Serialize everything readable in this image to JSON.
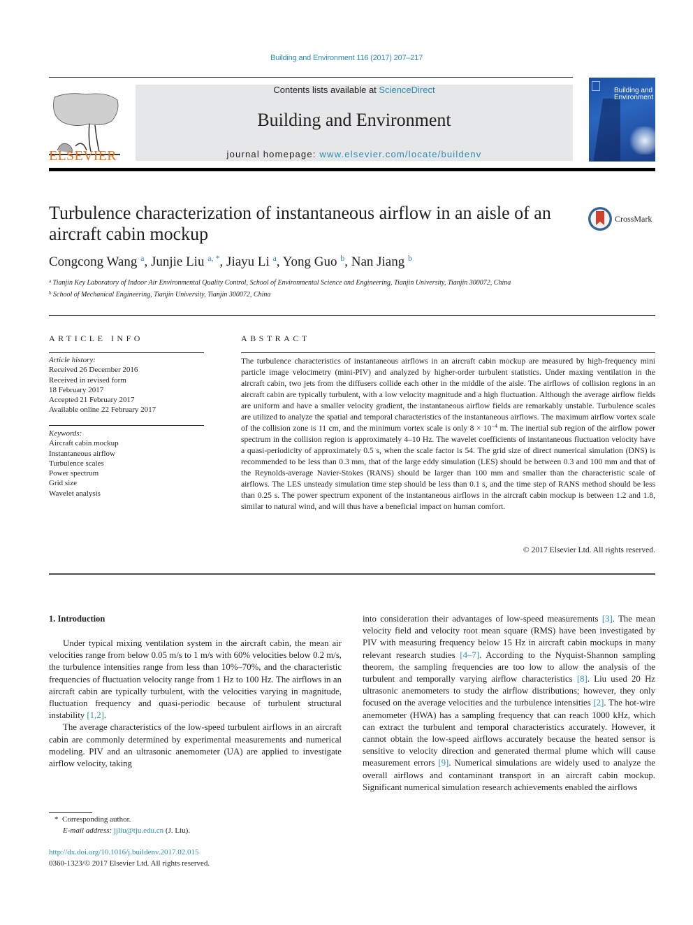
{
  "header": {
    "citation": "Building and Environment 116 (2017) 207–217",
    "contents_prefix": "Contents lists available at ",
    "contents_link": "ScienceDirect",
    "journal_name": "Building and Environment",
    "homepage_prefix": "journal homepage: ",
    "homepage_link": "www.elsevier.com/locate/buildenv",
    "publisher_logo_text": "ELSEVIER",
    "cover_title_line1": "Building and",
    "cover_title_line2": "Environment",
    "crossmark_label": "CrossMark"
  },
  "colors": {
    "link": "#2a8bb5",
    "elsevier_orange": "#e9711c",
    "banner_gray": "#e6e7e8",
    "text": "#231f20"
  },
  "article": {
    "title": "Turbulence characterization of instantaneous airflow in an aisle of an aircraft cabin mockup",
    "authors": [
      {
        "name": "Congcong Wang",
        "sup": "a"
      },
      {
        "name": "Junjie Liu",
        "sup": "a, *"
      },
      {
        "name": "Jiayu Li",
        "sup": "a"
      },
      {
        "name": "Yong Guo",
        "sup": "b"
      },
      {
        "name": "Nan Jiang",
        "sup": "b"
      }
    ],
    "affiliations": [
      {
        "sup": "a",
        "text": "Tianjin Key Laboratory of Indoor Air Environmental Quality Control, School of Environmental Science and Engineering, Tianjin University, Tianjin 300072, China"
      },
      {
        "sup": "b",
        "text": "School of Mechanical Engineering, Tianjin University, Tianjin 300072, China"
      }
    ]
  },
  "article_info": {
    "heading": "ARTICLE INFO",
    "history_label": "Article history:",
    "history": [
      "Received 26 December 2016",
      "Received in revised form",
      "18 February 2017",
      "Accepted 21 February 2017",
      "Available online 22 February 2017"
    ],
    "keywords_label": "Keywords:",
    "keywords": [
      "Aircraft cabin mockup",
      "Instantaneous airflow",
      "Turbulence scales",
      "Power spectrum",
      "Grid size",
      "Wavelet analysis"
    ]
  },
  "abstract": {
    "heading": "ABSTRACT",
    "part1": "The turbulence characteristics of instantaneous airflows in an aircraft cabin mockup are measured by high-frequency mini particle image velocimetry (mini-PIV) and analyzed by higher-order turbulent statistics. Under maxing ventilation in the aircraft cabin, two jets from the diffusers collide each other in the middle of the aisle. The airflows of collision regions in an aircraft cabin are typically turbulent, with a low velocity magnitude and a high fluctuation. Although the average airflow fields are uniform and have a smaller velocity gradient, the instantaneous airflow fields are remarkably unstable. Turbulence scales are utilized to analyze the spatial and temporal characteristics of the instantaneous airflows. The maximum airflow vortex scale of the collision zone is 11 cm, and the minimum vortex scale is only 8 × 10",
    "exponent": "−4",
    "part2": " m. The inertial sub region of the airflow power spectrum in the collision region is approximately 4–10 Hz. The wavelet coefficients of instantaneous fluctuation velocity have a quasi-periodicity of approximately 0.5 s, when the scale factor is 54. The grid size of direct numerical simulation (DNS) is recommended to be less than 0.3 mm, that of the large eddy simulation (LES) should be between 0.3 and 100 mm and that of the Reynolds-average Navier-Stokes (RANS) should be larger than 100 mm and smaller than the characteristic scale of airflows. The LES unsteady simulation time step should be less than 0.1 s, and the time step of RANS method should be less than 0.25 s. The power spectrum exponent of the instantaneous airflows in the aircraft cabin mockup is between 1.2 and 1.8, similar to natural wind, and will thus have a beneficial impact on human comfort.",
    "copyright": "© 2017 Elsevier Ltd. All rights reserved."
  },
  "introduction": {
    "heading": "1.  Introduction",
    "p1_text": "Under typical mixing ventilation system in the aircraft cabin, the mean air velocities range from below 0.05 m/s to 1 m/s with 60% velocities below 0.2 m/s, the turbulence intensities range from less than 10%–70%, and the characteristic frequencies of fluctuation velocity range from 1 Hz to 100 Hz. The airflows in an aircraft cabin are typically turbulent, with the velocities varying in magnitude, fluctuation frequency and quasi-periodic because of turbulent structural instability ",
    "p1_ref": "[1,2]",
    "p1_end": ".",
    "p2_text": "The average characteristics of the low-speed turbulent airflows in an aircraft cabin are commonly determined by experimental measurements and numerical modeling. PIV and an ultrasonic anemometer (UA) are applied to investigate airflow velocity, taking",
    "c2_t1": "into consideration their advantages of low-speed measurements ",
    "c2_r1": "[3]",
    "c2_t2": ". The mean velocity field and velocity root mean square (RMS) have been investigated by PIV with measuring frequency below 15 Hz in aircraft cabin mockups in many relevant research studies ",
    "c2_r2": "[4–7]",
    "c2_t3": ". According to the Nyquist-Shannon sampling theorem, the sampling frequencies are too low to allow the analysis of the turbulent and temporally varying airflow characteristics ",
    "c2_r3": "[8]",
    "c2_t4": ". Liu used 20 Hz ultrasonic anemometers to study the airflow distributions; however, they only focused on the average velocities and the turbulence intensities ",
    "c2_r4": "[2]",
    "c2_t5": ". The hot-wire anemometer (HWA) has a sampling frequency that can reach 1000 kHz, which can extract the turbulent and temporal characteristics accurately. However, it cannot obtain the low-speed airflows accurately because the heated sensor is sensitive to velocity direction and generated thermal plume which will cause measurement errors ",
    "c2_r5": "[9]",
    "c2_t6": ". Numerical simulations are widely used to analyze the overall airflows and contaminant transport in an aircraft cabin mockup. Significant numerical simulation research achievements enabled the airflows"
  },
  "footer": {
    "corresponding_mark": "*",
    "corresponding_text": "Corresponding author.",
    "email_label": "E-mail address:",
    "email": "jjliu@tju.edu.cn",
    "email_suffix": " (J. Liu).",
    "doi": "http://dx.doi.org/10.1016/j.buildenv.2017.02.015",
    "issn_copyright": "0360-1323/© 2017 Elsevier Ltd. All rights reserved."
  }
}
